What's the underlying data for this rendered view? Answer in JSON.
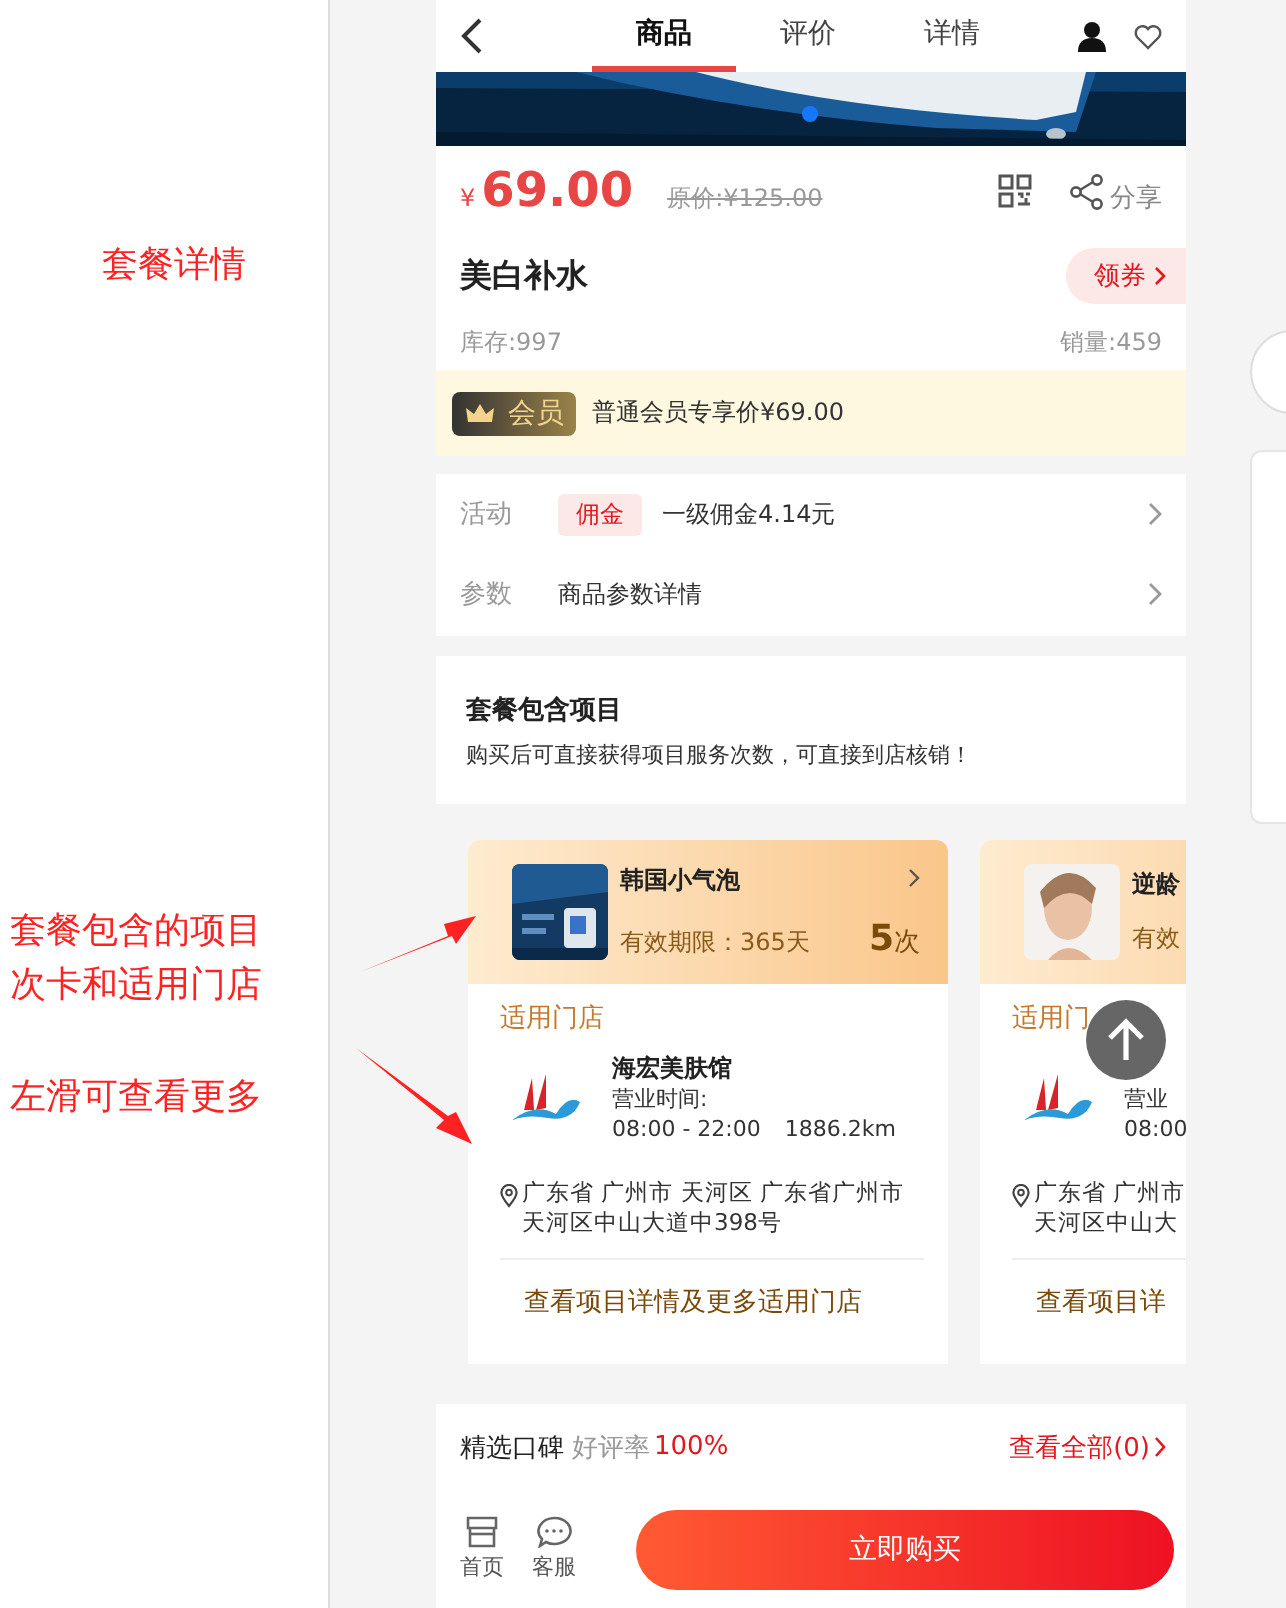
{
  "annotations": [
    "套餐详情",
    "套餐包含的项目次卡和适用门店",
    "左滑可查看更多"
  ],
  "nav": {
    "tabs": [
      {
        "label": "商品",
        "selected": true
      },
      {
        "label": "评价",
        "selected": false
      },
      {
        "label": "详情",
        "selected": false
      }
    ]
  },
  "product": {
    "currency": "¥",
    "price": "69.00",
    "original_price": "原价:¥125.00",
    "share": "分享",
    "name": "美白补水",
    "coupon": "领券",
    "stock": "库存:997",
    "sales": "销量:459"
  },
  "member": {
    "badge": "会员",
    "text": "普通会员专享价¥69.00"
  },
  "attributes": [
    {
      "label": "活动",
      "tag": "佣金",
      "text": "一级佣金4.14元"
    },
    {
      "label": "参数",
      "text": "商品参数详情"
    }
  ],
  "package": {
    "title": "套餐包含项目",
    "description": "购买后可直接获得项目服务次数，可直接到店核销！"
  },
  "projects": [
    {
      "name": "韩国小气泡",
      "validity": "有效期限：365天",
      "count": "5",
      "unit": "次",
      "stores_label": "适用门店",
      "store": {
        "name": "海宏美肤馆",
        "hours_label": "营业时间:",
        "hours": "08:00 - 22:00",
        "distance": "1886.2km",
        "address": [
          "广东省 广州市 天河区 广东省广州市",
          "天河区中山大道中398号"
        ]
      },
      "link": "查看项目详情及更多适用门店"
    },
    {
      "name": "逆龄",
      "validity": "有效",
      "stores_label": "适用门",
      "store": {
        "hours_label": "营业",
        "hours": "08:00",
        "address": [
          "广东省 广州市",
          "天河区中山大"
        ]
      },
      "link": "查看项目详"
    }
  ],
  "reviews": {
    "title": "精选口碑",
    "rate_label": "好评率",
    "rate": "100%",
    "view_all": "查看全部(0)"
  },
  "bottom_bar": {
    "items": [
      {
        "label": "首页",
        "kind": "shop"
      },
      {
        "label": "客服",
        "kind": "chat"
      }
    ],
    "buy": "立即购买"
  }
}
